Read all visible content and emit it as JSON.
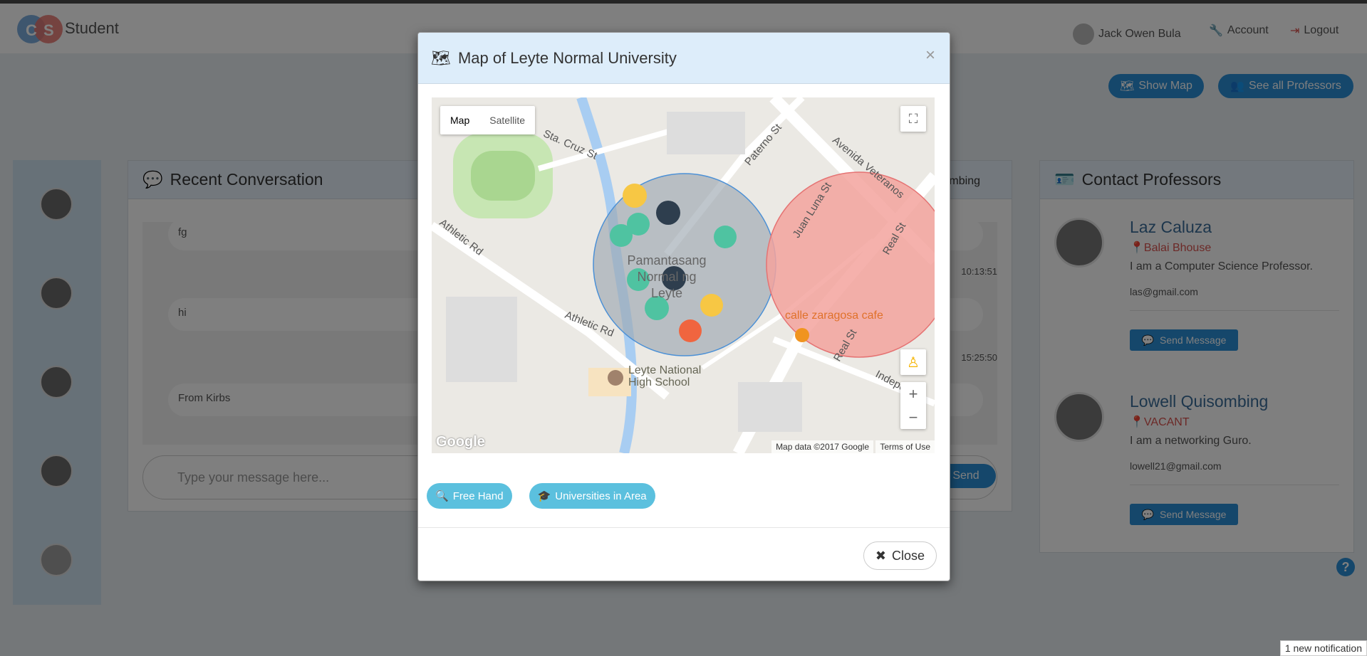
{
  "navbar": {
    "logo_letters": [
      "C",
      "S"
    ],
    "brand": "Student",
    "user_name": "Jack Owen Bula",
    "account": "Account",
    "logout": "Logout"
  },
  "actions": {
    "show_map": "Show Map",
    "see_all": "See all Professors"
  },
  "conversation": {
    "title": "Recent Conversation",
    "messages": [
      {
        "text": "fg",
        "time": ""
      },
      {
        "text": "hi",
        "time": "10:13:51"
      },
      {
        "text": "From Kirbs",
        "time": "15:25:50"
      }
    ],
    "partial_name": "mbing",
    "placeholder": "Type your message here...",
    "send": "Send"
  },
  "contacts": {
    "title": "Contact Professors",
    "professors": [
      {
        "name": "Laz Caluza",
        "location": "Balai Bhouse",
        "desc": "I am a Computer Science Professor.",
        "email": "las@gmail.com",
        "button": "Send Message"
      },
      {
        "name": "Lowell Quisombing",
        "location": "VACANT",
        "desc": "I am a networking Guro.",
        "email": "lowell21@gmail.com",
        "button": "Send Message"
      }
    ]
  },
  "modal": {
    "title": "Map of Leyte Normal University",
    "map_type": {
      "map": "Map",
      "satellite": "Satellite"
    },
    "labels": {
      "sta_cruz": "Sta. Cruz St",
      "paterno": "Paterno St",
      "avenida": "Avenida Veteranos",
      "juan_luna": "Juan Luna St",
      "athletic1": "Athletic Rd",
      "athletic2": "Athletic Rd",
      "real1": "Real St",
      "real2": "Real St",
      "independence": "Independe",
      "campus": "Pamantasang Normal ng Leyte",
      "cafe": "calle zaragosa cafe",
      "school1": "Leyte National",
      "school2": "High School"
    },
    "google": "Google",
    "map_data": "Map data ©2017 Google",
    "terms": "Terms of Use",
    "free_hand": "Free Hand",
    "universities": "Universities in Area",
    "close": "Close"
  },
  "notification": "1 new notification",
  "colors": {
    "accent": "#2b8fd6",
    "info": "#5bc0de",
    "danger": "#d9534f"
  }
}
